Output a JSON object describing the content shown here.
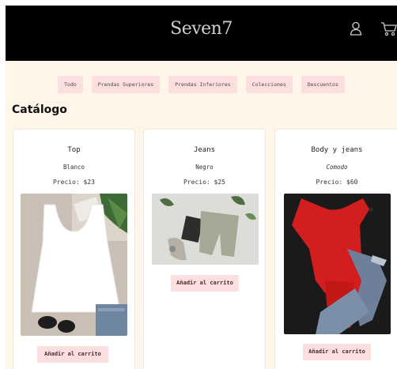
{
  "header": {
    "logo": "Seven7",
    "user_icon": "user-icon",
    "cart_icon": "cart-icon"
  },
  "nav": {
    "items": [
      {
        "label": "Todo"
      },
      {
        "label": "Prendas Superiores"
      },
      {
        "label": "Prendas Inferiores"
      },
      {
        "label": "Colecciones"
      },
      {
        "label": "Descuentos"
      }
    ]
  },
  "page_title": "Catálogo",
  "products": [
    {
      "name": "Top",
      "color": "Blanco",
      "price": "Precio: $23",
      "button": "Añadir al carrito"
    },
    {
      "name": "Jeans",
      "color": "Negro",
      "price": "Precio: $25",
      "button": "Añadir al carrito"
    },
    {
      "name": "Body y jeans",
      "color": "Comodo",
      "price": "Precio: $60",
      "button": "Añadir al carrito"
    }
  ],
  "colors": {
    "header_bg": "#000000",
    "page_bg": "#fff5e8",
    "button_bg": "#fbdede"
  }
}
